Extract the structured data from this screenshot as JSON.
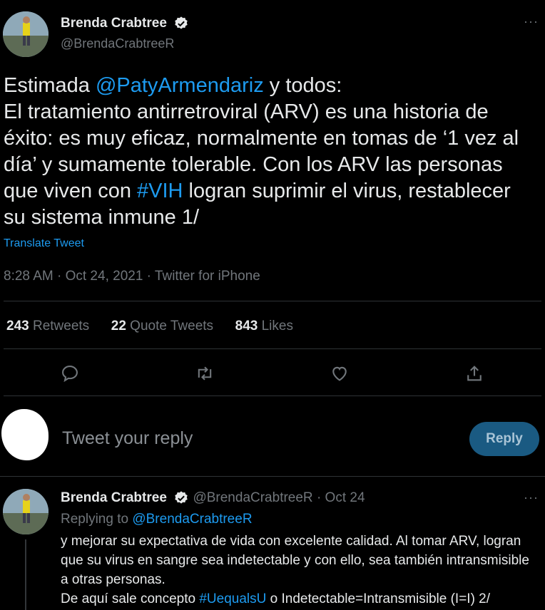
{
  "main_tweet": {
    "author_name": "Brenda Crabtree",
    "author_handle": "@BrendaCrabtreeR",
    "more_label": "···",
    "text_parts": {
      "intro": "Estimada ",
      "mention": "@PatyArmendariz",
      "after_mention": " y todos:",
      "line2": "El tratamiento antirretroviral (ARV) es una historia de éxito: es muy eficaz, normalmente en tomas de ‘1 vez al día’ y sumamente tolerable. Con los ARV las personas que viven con ",
      "hashtag": "#VIH",
      "after_hashtag": " logran suprimir el virus, restablecer su sistema inmune 1/"
    },
    "translate_label": "Translate Tweet",
    "meta": "8:28 AM · Oct 24, 2021 · Twitter for iPhone",
    "stats": {
      "retweets_count": "243",
      "retweets_label": "Retweets",
      "quotes_count": "22",
      "quotes_label": "Quote Tweets",
      "likes_count": "843",
      "likes_label": "Likes"
    }
  },
  "composer": {
    "placeholder": "Tweet your reply",
    "reply_button": "Reply"
  },
  "reply_tweet": {
    "author_name": "Brenda Crabtree",
    "author_handle": "@BrendaCrabtreeR",
    "dot": "·",
    "date": "Oct 24",
    "more_label": "···",
    "replying_to_label": "Replying to ",
    "replying_to_handle": "@BrendaCrabtreeR",
    "text_line1": "y mejorar su expectativa de vida con excelente calidad. Al tomar ARV, logran que su virus en sangre sea indetectable y con ello, sea también intransmisible a otras personas.",
    "text_line2_a": "De aquí sale concepto ",
    "text_line2_hashtag": "#UequalsU",
    "text_line2_b": " o Indetectable=Intransmisible (I=I) 2/"
  },
  "colors": {
    "background": "#000000",
    "text": "#e7e9ea",
    "muted": "#71767b",
    "link": "#1d9bf0",
    "divider": "#2f3336"
  }
}
